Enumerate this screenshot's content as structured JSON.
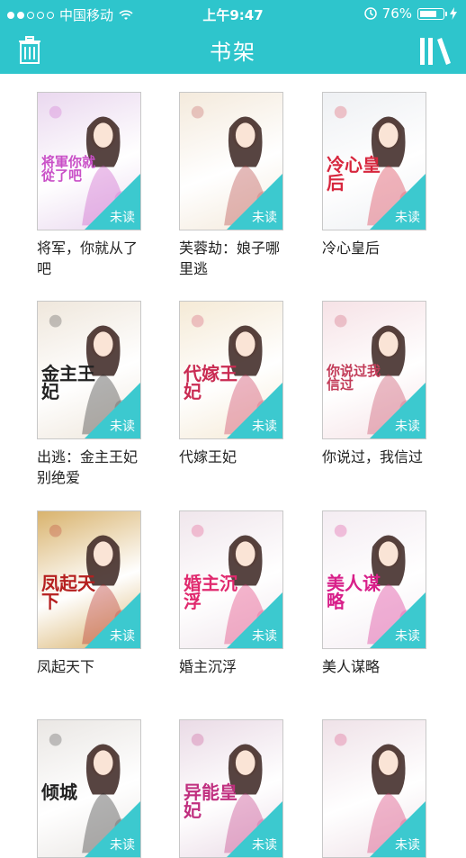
{
  "status": {
    "carrier": "中国移动",
    "time": "上午9:47",
    "battery": "76%",
    "battery_level": 0.76,
    "signal_bars": [
      true,
      true,
      false,
      false,
      false
    ]
  },
  "header": {
    "title": "书架"
  },
  "unread_label": "未读",
  "books": [
    {
      "title": "将军，你就从了吧",
      "cover_text": "将軍你就從了吧",
      "bg": "#ead8ef",
      "accent": "#c94fc7"
    },
    {
      "title": "芙蓉劫：娘子哪里逃",
      "cover_text": "",
      "bg": "#f4eadc",
      "accent": "#b2393a"
    },
    {
      "title": "冷心皇后",
      "cover_text": "冷心皇后",
      "bg": "#eef0f3",
      "accent": "#d7263d"
    },
    {
      "title": "出逃：金主王妃别绝爱",
      "cover_text": "金主王妃",
      "bg": "#efe7dc",
      "accent": "#222222"
    },
    {
      "title": "代嫁王妃",
      "cover_text": "代嫁王妃",
      "bg": "#f5ead6",
      "accent": "#c92b52"
    },
    {
      "title": "你说过，我信过",
      "cover_text": "你说过我信过",
      "bg": "#f6e2e6",
      "accent": "#c23b58"
    },
    {
      "title": "凤起天下",
      "cover_text": "凤起天下",
      "bg": "#d9b36d",
      "accent": "#b51f1f"
    },
    {
      "title": "婚主沉浮",
      "cover_text": "婚主沉浮",
      "bg": "#f0e6ec",
      "accent": "#e0296e"
    },
    {
      "title": "美人谋略",
      "cover_text": "美人谋略",
      "bg": "#f4ecf2",
      "accent": "#d81f89"
    },
    {
      "title": "",
      "cover_text": "倾城",
      "bg": "#eae7e4",
      "accent": "#222222"
    },
    {
      "title": "",
      "cover_text": "异能皇妃",
      "bg": "#eadbe6",
      "accent": "#c02f7f"
    },
    {
      "title": "",
      "cover_text": "",
      "bg": "#efe2e8",
      "accent": "#d32a6a"
    }
  ]
}
